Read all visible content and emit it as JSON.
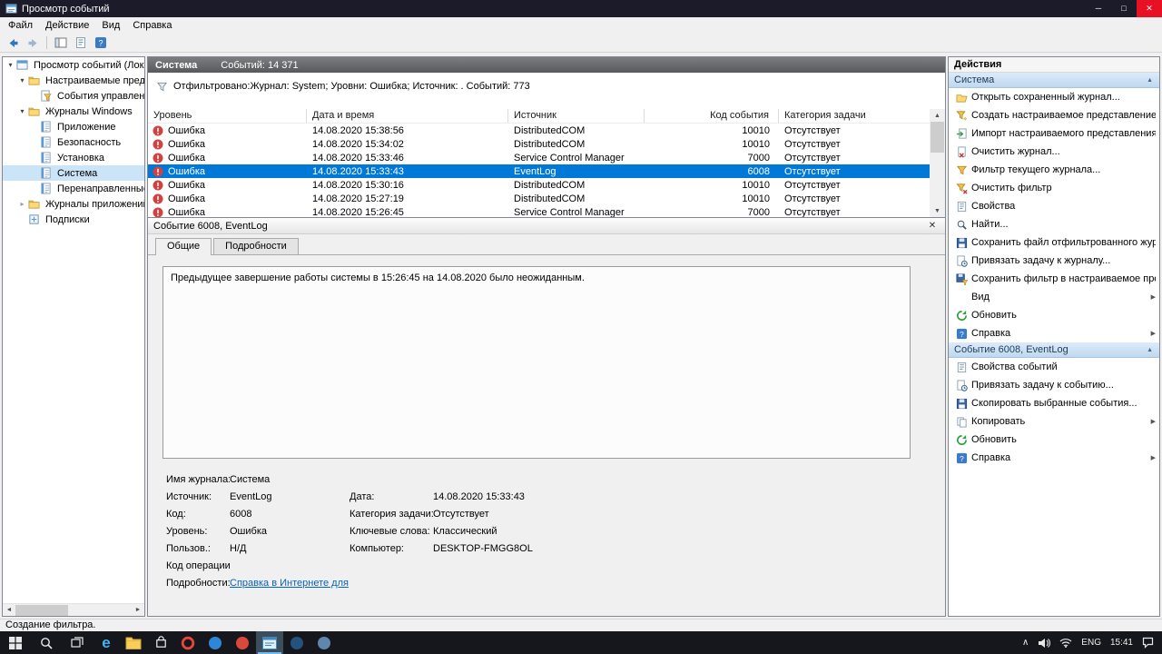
{
  "window": {
    "title": "Просмотр событий",
    "menu_items": [
      "Файл",
      "Действие",
      "Вид",
      "Справка"
    ],
    "status_text": "Создание фильтра."
  },
  "colors": {
    "selection": "#0078d7",
    "error": "#d43f3f",
    "titlebar": "#1c1b29",
    "close_button": "#e81123"
  },
  "tree": {
    "items": [
      {
        "label": "Просмотр событий (Локальн",
        "level": 0,
        "arrow": "expanded",
        "icon": "console",
        "selected": false
      },
      {
        "label": "Настраиваемые представле",
        "level": 1,
        "arrow": "expanded",
        "icon": "folder",
        "selected": false
      },
      {
        "label": "События управления",
        "level": 2,
        "arrow": "none",
        "icon": "custom-view",
        "selected": false
      },
      {
        "label": "Журналы Windows",
        "level": 1,
        "arrow": "expanded",
        "icon": "folder",
        "selected": false
      },
      {
        "label": "Приложение",
        "level": 2,
        "arrow": "none",
        "icon": "log",
        "selected": false
      },
      {
        "label": "Безопасность",
        "level": 2,
        "arrow": "none",
        "icon": "log",
        "selected": false
      },
      {
        "label": "Установка",
        "level": 2,
        "arrow": "none",
        "icon": "log",
        "selected": false
      },
      {
        "label": "Система",
        "level": 2,
        "arrow": "none",
        "icon": "log",
        "selected": true
      },
      {
        "label": "Перенаправленные соб",
        "level": 2,
        "arrow": "none",
        "icon": "log",
        "selected": false
      },
      {
        "label": "Журналы приложений и сл",
        "level": 1,
        "arrow": "collapsed",
        "icon": "folder",
        "selected": false
      },
      {
        "label": "Подписки",
        "level": 1,
        "arrow": "none",
        "icon": "subscriptions",
        "selected": false
      }
    ]
  },
  "events": {
    "header_title": "Система",
    "header_count": "Событий: 14 371",
    "filter_text": "Отфильтровано:Журнал: System; Уровни: Ошибка; Источник: . Событий: 773",
    "columns": [
      "Уровень",
      "Дата и время",
      "Источник",
      "Код события",
      "Категория задачи"
    ],
    "rows": [
      {
        "level": "Ошибка",
        "datetime": "14.08.2020 15:38:56",
        "source": "DistributedCOM",
        "event_id": "10010",
        "category": "Отсутствует",
        "selected": false
      },
      {
        "level": "Ошибка",
        "datetime": "14.08.2020 15:34:02",
        "source": "DistributedCOM",
        "event_id": "10010",
        "category": "Отсутствует",
        "selected": false
      },
      {
        "level": "Ошибка",
        "datetime": "14.08.2020 15:33:46",
        "source": "Service Control Manager",
        "event_id": "7000",
        "category": "Отсутствует",
        "selected": false
      },
      {
        "level": "Ошибка",
        "datetime": "14.08.2020 15:33:43",
        "source": "EventLog",
        "event_id": "6008",
        "category": "Отсутствует",
        "selected": true
      },
      {
        "level": "Ошибка",
        "datetime": "14.08.2020 15:30:16",
        "source": "DistributedCOM",
        "event_id": "10010",
        "category": "Отсутствует",
        "selected": false
      },
      {
        "level": "Ошибка",
        "datetime": "14.08.2020 15:27:19",
        "source": "DistributedCOM",
        "event_id": "10010",
        "category": "Отсутствует",
        "selected": false
      },
      {
        "level": "Ошибка",
        "datetime": "14.08.2020 15:26:45",
        "source": "Service Control Manager",
        "event_id": "7000",
        "category": "Отсутствует",
        "selected": false
      }
    ]
  },
  "detail": {
    "title": "Событие 6008, EventLog",
    "tabs": [
      "Общие",
      "Подробности"
    ],
    "active_tab": "Общие",
    "description": "Предыдущее завершение работы системы в 15:26:45 на 14.08.2020 было неожиданным.",
    "fields": [
      {
        "l1": "Имя журнала:",
        "v1": "Система",
        "l2": "",
        "v2": ""
      },
      {
        "l1": "Источник:",
        "v1": "EventLog",
        "l2": "Дата:",
        "v2": "14.08.2020 15:33:43"
      },
      {
        "l1": "Код:",
        "v1": "6008",
        "l2": "Категория задачи:",
        "v2": "Отсутствует"
      },
      {
        "l1": "Уровень:",
        "v1": "Ошибка",
        "l2": "Ключевые слова:",
        "v2": "Классический"
      },
      {
        "l1": "Пользов.:",
        "v1": "Н/Д",
        "l2": "Компьютер:",
        "v2": "DESKTOP-FMGG8OL"
      },
      {
        "l1": "Код операции:",
        "v1": "",
        "l2": "",
        "v2": ""
      },
      {
        "l1": "Подробности:",
        "v1": "Справка в Интернете для",
        "link": true,
        "l2": "",
        "v2": ""
      }
    ]
  },
  "actions": {
    "title": "Действия",
    "sections": [
      {
        "header": "Система",
        "items": [
          {
            "label": "Открыть сохраненный журнал...",
            "icon": "folder-open",
            "submenu": false
          },
          {
            "label": "Создать настраиваемое представление...",
            "icon": "filter-new",
            "submenu": false
          },
          {
            "label": "Импорт настраиваемого представления",
            "icon": "import",
            "submenu": false
          },
          {
            "label": "Очистить журнал...",
            "icon": "clear",
            "submenu": false
          },
          {
            "label": "Фильтр текущего журнала...",
            "icon": "filter",
            "submenu": false
          },
          {
            "label": "Очистить фильтр",
            "icon": "clear-filter",
            "submenu": false
          },
          {
            "label": "Свойства",
            "icon": "properties",
            "submenu": false
          },
          {
            "label": "Найти...",
            "icon": "find",
            "submenu": false
          },
          {
            "label": "Сохранить файл отфильтрованного жур...",
            "icon": "save",
            "submenu": false
          },
          {
            "label": "Привязать задачу к журналу...",
            "icon": "task",
            "submenu": false
          },
          {
            "label": "Сохранить фильтр в настраиваемое пред...",
            "icon": "save-filter",
            "submenu": false
          },
          {
            "label": "Вид",
            "icon": "none",
            "submenu": true
          },
          {
            "label": "Обновить",
            "icon": "refresh",
            "submenu": false
          },
          {
            "label": "Справка",
            "icon": "help",
            "submenu": true
          }
        ]
      },
      {
        "header": "Событие 6008, EventLog",
        "items": [
          {
            "label": "Свойства событий",
            "icon": "properties",
            "submenu": false
          },
          {
            "label": "Привязать задачу к событию...",
            "icon": "task",
            "submenu": false
          },
          {
            "label": "Скопировать выбранные события...",
            "icon": "save",
            "submenu": false
          },
          {
            "label": "Копировать",
            "icon": "copy",
            "submenu": true
          },
          {
            "label": "Обновить",
            "icon": "refresh",
            "submenu": false
          },
          {
            "label": "Справка",
            "icon": "help",
            "submenu": true
          }
        ]
      }
    ]
  },
  "taskbar": {
    "language": "ENG",
    "time": "15:41",
    "apps": [
      {
        "name": "edge",
        "type": "glyph",
        "glyph": "e",
        "color": "#3fb6f2",
        "active": false
      },
      {
        "name": "file-explorer",
        "type": "folder",
        "color": "#f8ce56",
        "active": false
      },
      {
        "name": "microsoft-store",
        "type": "store",
        "color": "#ffffff",
        "active": false
      },
      {
        "name": "opera",
        "type": "ring",
        "color": "#e8453c",
        "active": false
      },
      {
        "name": "blue-circle-app",
        "type": "disc",
        "color": "#2f86d6",
        "active": false
      },
      {
        "name": "red-circle-app",
        "type": "disc",
        "color": "#d9483b",
        "active": false
      },
      {
        "name": "event-viewer",
        "type": "panel",
        "color": "#bfe3f2",
        "active": true
      },
      {
        "name": "navy-circle-app",
        "type": "disc",
        "color": "#23527c",
        "active": false
      },
      {
        "name": "steel-circle-app",
        "type": "disc",
        "color": "#5f86ad",
        "active": false
      }
    ]
  }
}
